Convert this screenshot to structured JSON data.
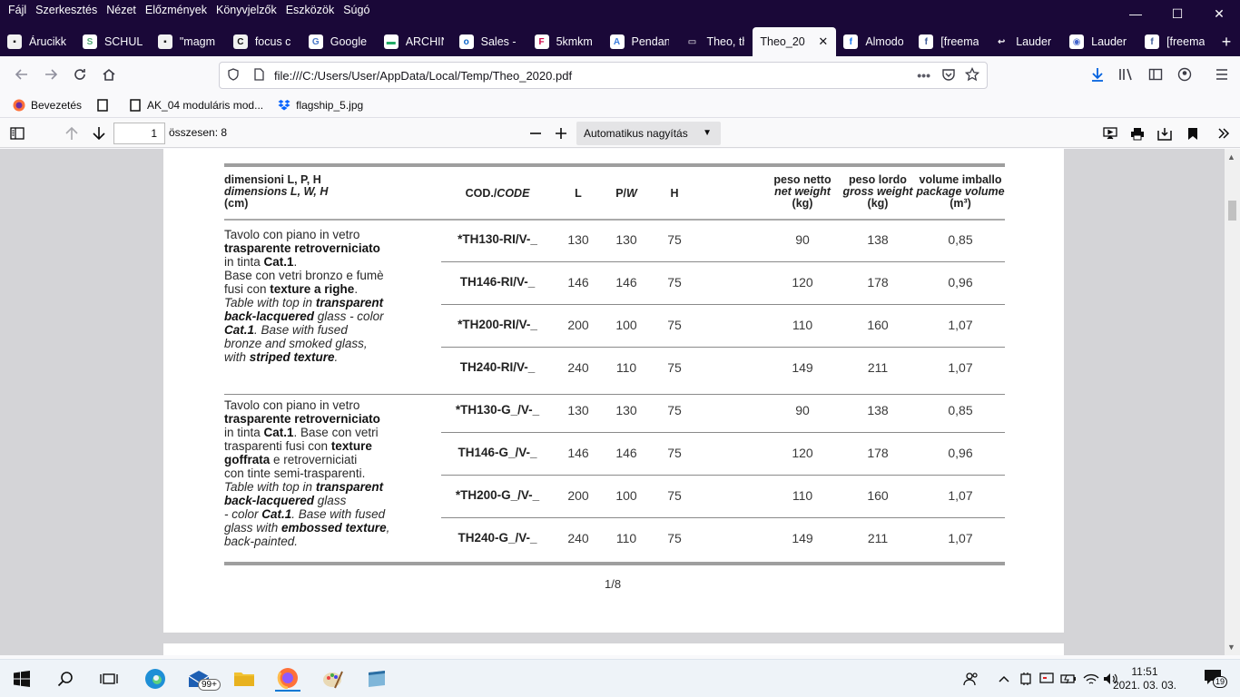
{
  "menubar": {
    "items": [
      "Fájl",
      "Szerkesztés",
      "Nézet",
      "Előzmények",
      "Könyvjelzők",
      "Eszközök",
      "Súgó"
    ],
    "minimize": "—",
    "maximize": "☐",
    "close": "✕"
  },
  "tabs": [
    {
      "label": "Árucikk",
      "fav": "▪",
      "color": "#222"
    },
    {
      "label": "SCHULL",
      "fav": "S",
      "color": "#5a7"
    },
    {
      "label": "\"magm",
      "fav": "▪",
      "color": "#222"
    },
    {
      "label": "focus c",
      "fav": "C",
      "color": "#111"
    },
    {
      "label": "Google",
      "fav": "G",
      "color": "#4a78c8"
    },
    {
      "label": "ARCHIN",
      "fav": "▬",
      "color": "#2a6"
    },
    {
      "label": "Sales - ",
      "fav": "o",
      "color": "#0a64c8"
    },
    {
      "label": "5kmkm",
      "fav": "F",
      "color": "#c04"
    },
    {
      "label": "Pendan",
      "fav": "A",
      "color": "#3b7ddd"
    },
    {
      "label": "Theo, th",
      "fav": "▭",
      "color": "#fff"
    },
    {
      "label": "Theo_20",
      "fav": "",
      "color": "#fff",
      "active": true
    },
    {
      "label": "Almodo",
      "fav": "f",
      "color": "#1877f2"
    },
    {
      "label": "[freema",
      "fav": "f",
      "color": "#3b5998"
    },
    {
      "label": "Lauder ",
      "fav": "↩",
      "color": "#fff"
    },
    {
      "label": "Lauder ",
      "fav": "◉",
      "color": "#46c"
    },
    {
      "label": "[freema",
      "fav": "f",
      "color": "#3b5998"
    }
  ],
  "newtab": "+",
  "address": {
    "url": "file:///C:/Users/User/AppData/Local/Temp/Theo_2020.pdf",
    "more": "•••"
  },
  "bookmarks": [
    {
      "label": "Bevezetés",
      "icon": "firefox-icon"
    },
    {
      "label": "",
      "icon": "page-icon"
    },
    {
      "label": "AK_04 moduláris mod...",
      "icon": "page-icon"
    },
    {
      "label": "flagship_5.jpg",
      "icon": "dropbox-icon"
    }
  ],
  "pdf": {
    "page_number": "1",
    "page_count": "összesen: 8",
    "zoom": "Automatikus nagyítás",
    "footer": "1/8"
  },
  "table": {
    "headers": {
      "dims_it": "dimensioni L, P, H",
      "dims_en": "dimensions L, W, H",
      "dims_unit": "(cm)",
      "code": "COD./",
      "code_en": "CODE",
      "L": "L",
      "P": "P/",
      "W": "W",
      "H": "H",
      "net_it": "peso netto",
      "net_en": "net weight",
      "net_unit": "(kg)",
      "gross_it": "peso lordo",
      "gross_en": "gross weight",
      "gross_unit": "(kg)",
      "vol_it": "volume imballo",
      "vol_en": "package volume",
      "vol_unit": "(m³)"
    },
    "rows": [
      {
        "code": "*TH130-RI/V-_",
        "L": "130",
        "P": "130",
        "H": "75",
        "net": "90",
        "gross": "138",
        "vol": "0,85"
      },
      {
        "code": "TH146-RI/V-_",
        "L": "146",
        "P": "146",
        "H": "75",
        "net": "120",
        "gross": "178",
        "vol": "0,96"
      },
      {
        "code": "*TH200-RI/V-_",
        "L": "200",
        "P": "100",
        "H": "75",
        "net": "110",
        "gross": "160",
        "vol": "1,07"
      },
      {
        "code": "TH240-RI/V-_",
        "L": "240",
        "P": "110",
        "H": "75",
        "net": "149",
        "gross": "211",
        "vol": "1,07"
      },
      {
        "code": "*TH130-G_/V-_",
        "L": "130",
        "P": "130",
        "H": "75",
        "net": "90",
        "gross": "138",
        "vol": "0,85"
      },
      {
        "code": "TH146-G_/V-_",
        "L": "146",
        "P": "146",
        "H": "75",
        "net": "120",
        "gross": "178",
        "vol": "0,96"
      },
      {
        "code": "*TH200-G_/V-_",
        "L": "200",
        "P": "100",
        "H": "75",
        "net": "110",
        "gross": "160",
        "vol": "1,07"
      },
      {
        "code": "TH240-G_/V-_",
        "L": "240",
        "P": "110",
        "H": "75",
        "net": "149",
        "gross": "211",
        "vol": "1,07"
      }
    ],
    "group1": {
      "l1": "Tavolo con piano in vetro",
      "l2": "trasparente retroverniciato",
      "l3a": "in tinta ",
      "l3b": "Cat.1",
      "l3c": ".",
      "l4": "Base con vetri bronzo e fumè",
      "l5a": "fusi con ",
      "l5b": "texture a righe",
      "l5c": ".",
      "l6a": "Table with top in ",
      "l6b": "transparent",
      "l7a": "back-lacquered",
      "l7b": " glass - color",
      "l8a": "Cat.1",
      "l8b": ". Base with fused",
      "l9": "bronze and smoked glass,",
      "l10a": "with ",
      "l10b": "striped texture",
      "l10c": "."
    },
    "group2": {
      "l1": "Tavolo con piano in vetro",
      "l2": "trasparente retroverniciato",
      "l3a": "in tinta ",
      "l3b": "Cat.1",
      "l3c": ". Base con vetri",
      "l4a": "trasparenti fusi con ",
      "l4b": "texture",
      "l5a": "goffrata",
      "l5b": " e retroverniciati",
      "l6": "con tinte semi-trasparenti.",
      "l7a": "Table with top in ",
      "l7b": "transparent",
      "l8a": "back-lacquered",
      "l8b": " glass",
      "l9a": "- color ",
      "l9b": "Cat.1",
      "l9c": ". Base with fused",
      "l10a": "glass with ",
      "l10b": "embossed texture",
      "l10c": ",",
      "l11": "back-painted."
    }
  },
  "taskbar": {
    "badge": "99+",
    "time": "11:51",
    "date": "2021. 03. 03.",
    "notifications": "19"
  }
}
